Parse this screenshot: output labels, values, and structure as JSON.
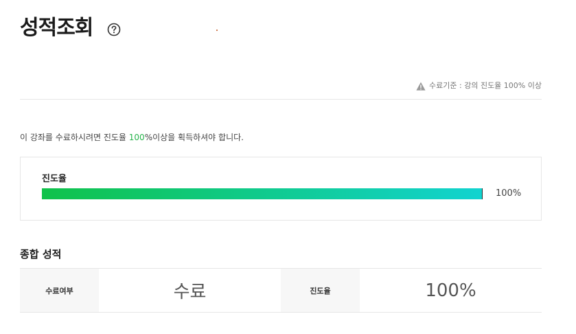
{
  "header": {
    "title": "성적조회",
    "help_icon": "question-circle-icon"
  },
  "criteria": {
    "icon": "warning-triangle-icon",
    "text": "수료기준 : 강의 진도율 100% 이상"
  },
  "notice": {
    "before": "이 강좌를 수료하시려면 진도율 ",
    "highlight": "100",
    "after": "%이상을 획득하셔야 합니다.",
    "highlight_color": "#27b34b"
  },
  "progress": {
    "label": "진도율",
    "percent": 100,
    "value_text": "100%",
    "gradient_start": "#10c24a",
    "gradient_end": "#11d3d0"
  },
  "summary": {
    "title": "종합 성적",
    "completion_label": "수료여부",
    "completion_value": "수료",
    "progress_label": "진도율",
    "progress_value": "100%"
  }
}
